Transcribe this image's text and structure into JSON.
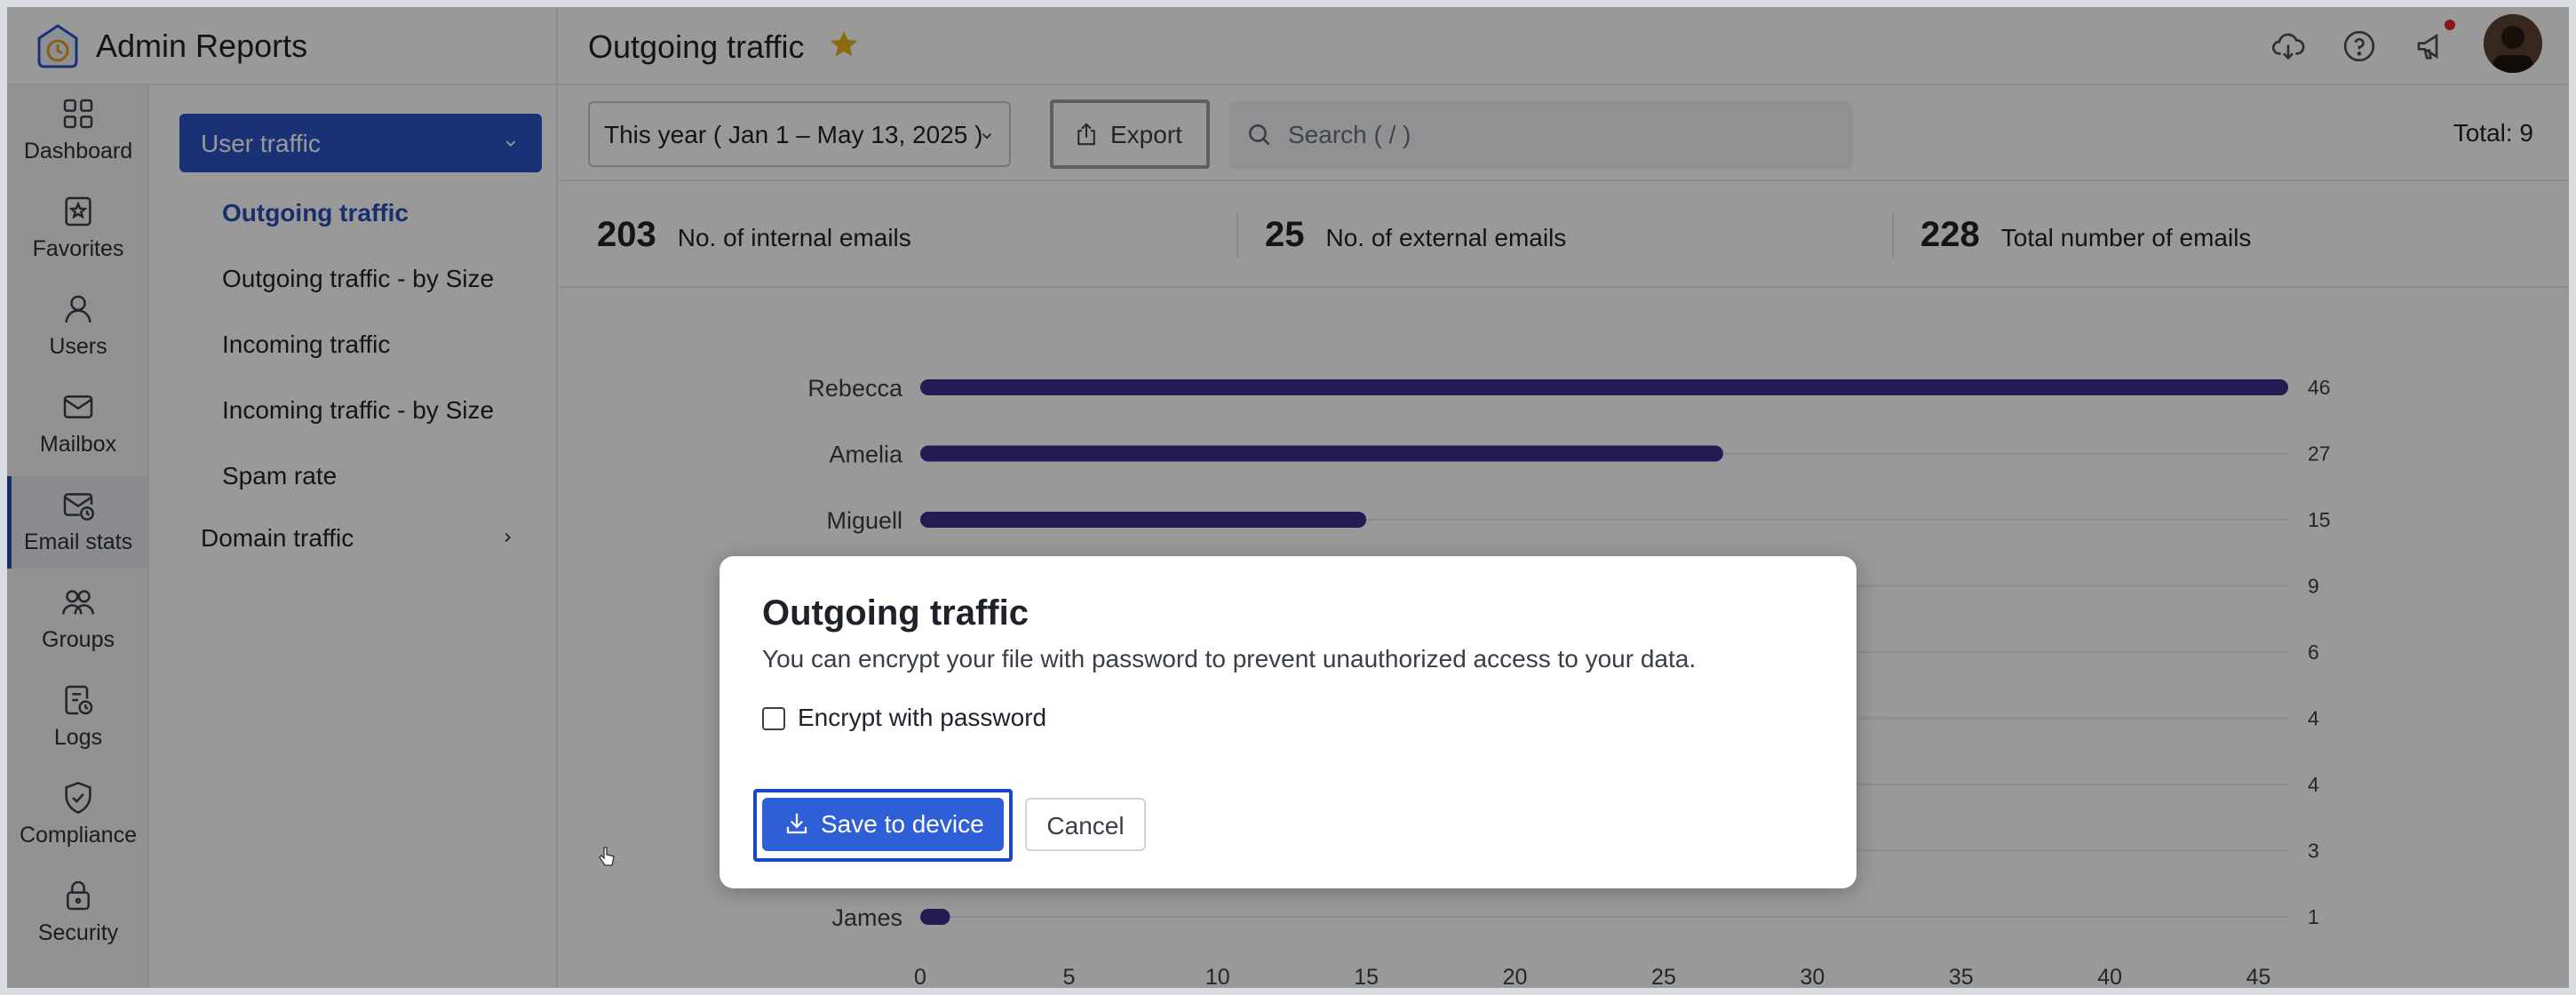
{
  "app": {
    "title": "Admin Reports"
  },
  "header": {
    "page_title": "Outgoing traffic"
  },
  "rail": {
    "items": [
      {
        "label": "Dashboard",
        "icon": "grid-icon"
      },
      {
        "label": "Favorites",
        "icon": "favorites-icon"
      },
      {
        "label": "Users",
        "icon": "user-icon"
      },
      {
        "label": "Mailbox",
        "icon": "mail-icon"
      },
      {
        "label": "Email stats",
        "icon": "email-stats-icon",
        "active": true
      },
      {
        "label": "Groups",
        "icon": "groups-icon"
      },
      {
        "label": "Logs",
        "icon": "logs-icon"
      },
      {
        "label": "Compliance",
        "icon": "compliance-icon"
      },
      {
        "label": "Security",
        "icon": "lock-icon"
      }
    ]
  },
  "subnav": {
    "group_label": "User traffic",
    "items": [
      {
        "label": "Outgoing traffic",
        "active": true
      },
      {
        "label": "Outgoing traffic - by Size"
      },
      {
        "label": "Incoming traffic"
      },
      {
        "label": "Incoming traffic - by Size"
      },
      {
        "label": "Spam rate"
      }
    ],
    "domain_label": "Domain traffic"
  },
  "toolbar": {
    "date_range": "This year ( Jan 1 – May 13, 2025 )",
    "export_label": "Export",
    "search_placeholder": "Search ( / )",
    "total": "Total: 9"
  },
  "stats": [
    {
      "value": "203",
      "label": "No. of internal emails"
    },
    {
      "value": "25",
      "label": "No. of external emails"
    },
    {
      "value": "228",
      "label": "Total number of emails"
    }
  ],
  "chart_data": {
    "type": "bar",
    "orientation": "horizontal",
    "categories": [
      "Rebecca",
      "Amelia",
      "Miguell",
      "",
      "",
      "",
      "",
      "",
      "James"
    ],
    "values": [
      46,
      27,
      15,
      9,
      6,
      4,
      4,
      3,
      1
    ],
    "xlim": [
      0,
      46
    ],
    "xticks": [
      0,
      5,
      10,
      15,
      20,
      25,
      30,
      35,
      40,
      45
    ],
    "bar_color": "#3b2f8c",
    "grid": true
  },
  "dialog": {
    "title": "Outgoing traffic",
    "description": "You can encrypt your file with password to prevent unauthorized access to your data.",
    "checkbox_label": "Encrypt with password",
    "save_label": "Save to device",
    "cancel_label": "Cancel"
  },
  "colors": {
    "accent": "#2c52c5",
    "primary_button": "#2f5fd6",
    "star": "#e6b219",
    "notification": "#e02828"
  }
}
